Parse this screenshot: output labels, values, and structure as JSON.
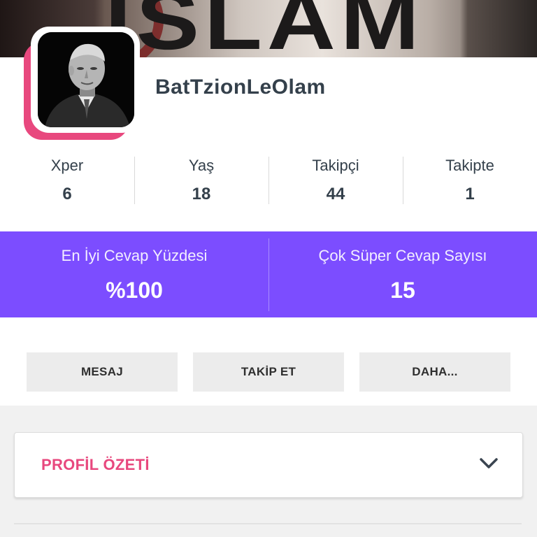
{
  "cover": {
    "text": "ISLAM"
  },
  "profile": {
    "username": "BatTzionLeOlam"
  },
  "stats": [
    {
      "label": "Xper",
      "value": "6"
    },
    {
      "label": "Yaş",
      "value": "18"
    },
    {
      "label": "Takipçi",
      "value": "44"
    },
    {
      "label": "Takipte",
      "value": "1"
    }
  ],
  "highlights": [
    {
      "label": "En İyi Cevap Yüzdesi",
      "value": "%100"
    },
    {
      "label": "Çok Süper Cevap Sayısı",
      "value": "15"
    }
  ],
  "actions": {
    "message": "MESAJ",
    "follow": "TAKİP ET",
    "more": "DAHA..."
  },
  "summary": {
    "title": "PROFİL ÖZETİ",
    "icon": "chevron-down-icon"
  },
  "colors": {
    "accent_pink": "#e8487e",
    "band_purple": "#7c4dff",
    "text_dark": "#34404b"
  }
}
